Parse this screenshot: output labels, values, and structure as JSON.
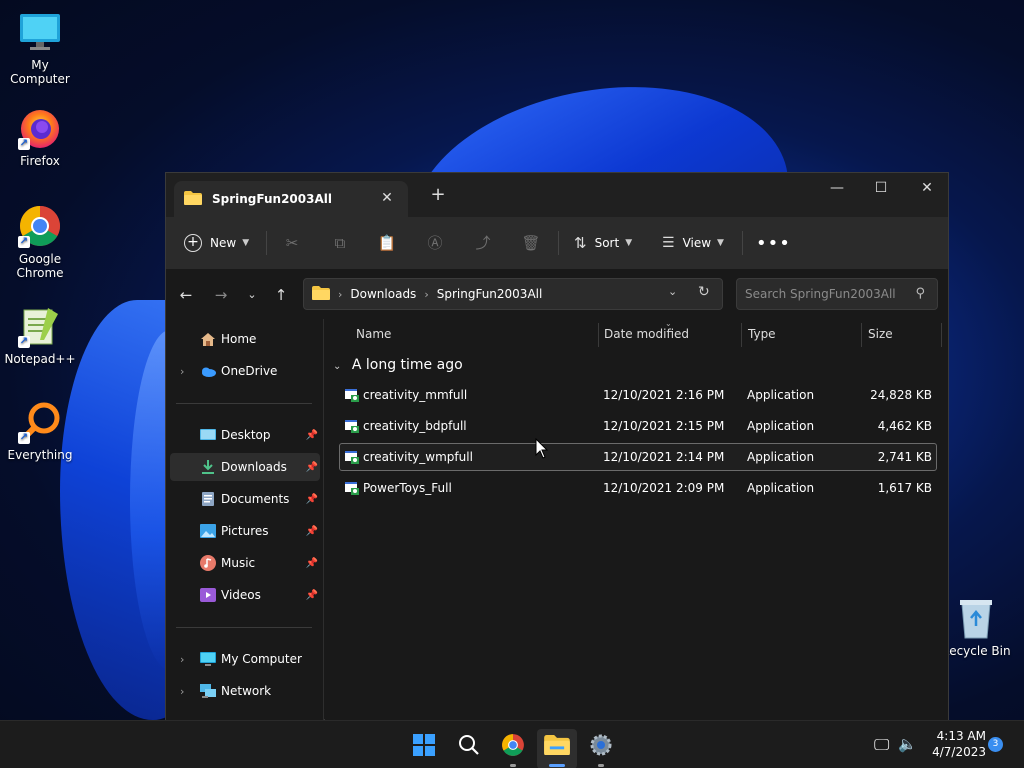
{
  "desktop": {
    "icons": [
      {
        "label": "My Computer",
        "icon": "monitor-icon"
      },
      {
        "label": "Firefox",
        "icon": "firefox-icon"
      },
      {
        "label": "Google Chrome",
        "icon": "chrome-icon"
      },
      {
        "label": "Notepad++",
        "icon": "notepadpp-icon"
      },
      {
        "label": "Everything",
        "icon": "everything-icon"
      },
      {
        "label": "Recycle Bin",
        "icon": "recycle-bin-icon"
      }
    ]
  },
  "window": {
    "tab_title": "SpringFun2003All",
    "toolbar": {
      "new_label": "New",
      "sort_label": "Sort",
      "view_label": "View"
    },
    "address": {
      "segments": [
        "Downloads",
        "SpringFun2003All"
      ]
    },
    "search": {
      "placeholder": "Search SpringFun2003All"
    },
    "sidebar": {
      "top": [
        {
          "label": "Home",
          "icon": "home-icon"
        },
        {
          "label": "OneDrive",
          "icon": "cloud-icon"
        }
      ],
      "pinned": [
        {
          "label": "Desktop",
          "icon": "desktop-icon"
        },
        {
          "label": "Downloads",
          "icon": "download-icon"
        },
        {
          "label": "Documents",
          "icon": "documents-icon"
        },
        {
          "label": "Pictures",
          "icon": "pictures-icon"
        },
        {
          "label": "Music",
          "icon": "music-icon"
        },
        {
          "label": "Videos",
          "icon": "videos-icon"
        }
      ],
      "bottom": [
        {
          "label": "My Computer",
          "icon": "computer-icon"
        },
        {
          "label": "Network",
          "icon": "network-icon"
        }
      ]
    },
    "columns": {
      "name": "Name",
      "date": "Date modified",
      "type": "Type",
      "size": "Size"
    },
    "group_label": "A long time ago",
    "files": [
      {
        "name": "creativity_mmfull",
        "date": "12/10/2021 2:16 PM",
        "type": "Application",
        "size": "24,828 KB"
      },
      {
        "name": "creativity_bdpfull",
        "date": "12/10/2021 2:15 PM",
        "type": "Application",
        "size": "4,462 KB"
      },
      {
        "name": "creativity_wmpfull",
        "date": "12/10/2021 2:14 PM",
        "type": "Application",
        "size": "2,741 KB"
      },
      {
        "name": "PowerToys_Full",
        "date": "12/10/2021 2:09 PM",
        "type": "Application",
        "size": "1,617 KB"
      }
    ]
  },
  "taskbar": {
    "time": "4:13 AM",
    "date": "4/7/2023",
    "notification_count": "3"
  }
}
